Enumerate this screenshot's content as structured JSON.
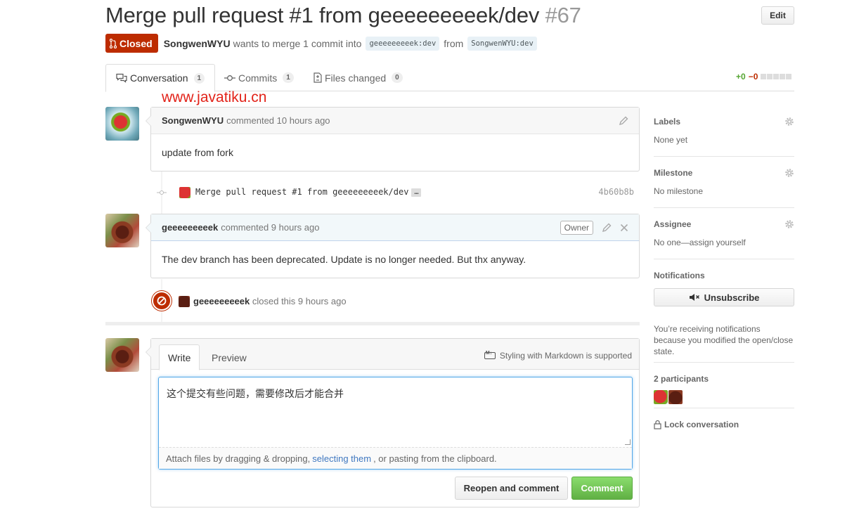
{
  "header": {
    "title": "Merge pull request #1 from geeeeeeeeek/dev",
    "number": "#67",
    "edit_label": "Edit",
    "state_label": "Closed",
    "author": "SongwenWYU",
    "meta_text": "wants to merge 1 commit into",
    "base_branch": "geeeeeeeeek:dev",
    "from_text": "from",
    "head_branch": "SongwenWYU:dev"
  },
  "tabs": [
    {
      "label": "Conversation",
      "count": "1"
    },
    {
      "label": "Commits",
      "count": "1"
    },
    {
      "label": "Files changed",
      "count": "0"
    }
  ],
  "diffstat": {
    "additions": "+0",
    "deletions": "−0"
  },
  "watermark": "www.javatiku.cn",
  "comments": [
    {
      "author": "SongwenWYU",
      "action": "commented 10 hours ago",
      "body": "update from fork"
    },
    {
      "author": "geeeeeeeeek",
      "action": "commented 9 hours ago",
      "badge": "Owner",
      "body": "The dev branch has been deprecated. Update is no longer needed. But thx anyway."
    }
  ],
  "commit": {
    "message": "Merge pull request #1 from geeeeeeeeek/dev",
    "ellipsis": "…",
    "sha": "4b60b8b"
  },
  "closed_event": {
    "actor": "geeeeeeeeek",
    "text": "closed this 9 hours ago"
  },
  "form": {
    "write_tab": "Write",
    "preview_tab": "Preview",
    "markdown_note": "Styling with Markdown is supported",
    "text": "这个提交有些问题，需要修改后才能合并",
    "attach_prefix": "Attach files by dragging & dropping,",
    "attach_link": "selecting them",
    "attach_suffix": ", or pasting from the clipboard.",
    "reopen_label": "Reopen and comment",
    "comment_label": "Comment"
  },
  "sidebar": {
    "labels_title": "Labels",
    "labels_value": "None yet",
    "milestone_title": "Milestone",
    "milestone_value": "No milestone",
    "assignee_title": "Assignee",
    "assignee_value": "No one—assign yourself",
    "notifications_title": "Notifications",
    "unsubscribe_label": "Unsubscribe",
    "notifications_note": "You’re receiving notifications because you modified the open/close state.",
    "participants_title": "2 participants",
    "lock_label": "Lock conversation"
  },
  "colors": {
    "closed": "#bd2c00",
    "comment_button": "#60b044",
    "link": "#4078c0",
    "watermark": "#e2231a"
  }
}
